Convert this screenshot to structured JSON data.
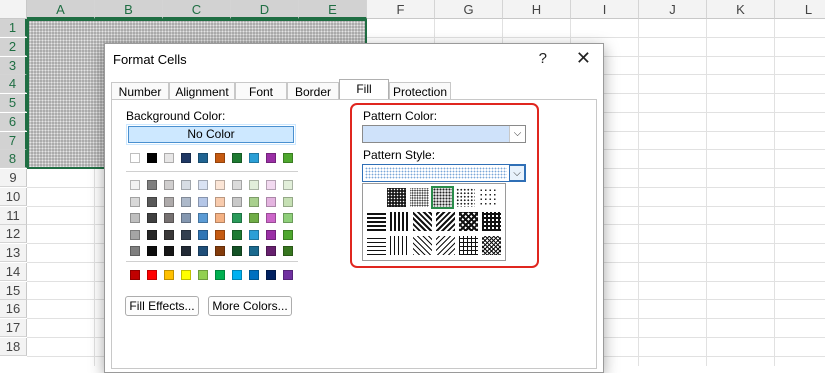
{
  "sheet": {
    "columns": [
      "A",
      "B",
      "C",
      "D",
      "E",
      "F",
      "G",
      "H",
      "I",
      "J",
      "K",
      "L"
    ],
    "rows": [
      "1",
      "2",
      "3",
      "4",
      "5",
      "6",
      "7",
      "8",
      "9",
      "10",
      "11",
      "12",
      "13",
      "14",
      "15",
      "16",
      "17",
      "18"
    ]
  },
  "dialog": {
    "title": "Format Cells",
    "help": "?",
    "close": "✕",
    "tabs": [
      "Number",
      "Alignment",
      "Font",
      "Border",
      "Fill",
      "Protection"
    ],
    "active_tab": "Fill",
    "background_color_label": "Background Color:",
    "no_color_label": "No Color",
    "pattern_color_label": "Pattern Color:",
    "pattern_style_label": "Pattern Style:",
    "fill_effects_label": "Fill Effects...",
    "more_colors_label": "More Colors...",
    "combo_arrow": "⌵"
  },
  "colors": {
    "accent_green": "#1f6e43",
    "highlight_red": "#e0261f",
    "selection_blue": "#cde8ff"
  },
  "palette": {
    "theme_top": [
      "#ffffff",
      "#000000",
      "#e7e6e6",
      "#44546a",
      "#4472c4",
      "#ed7d31",
      "#a5a5a5",
      "#ffc000",
      "#5b9bd5",
      "#70ad47"
    ],
    "theme_top_shown": [
      "#ffffff",
      "#000000",
      "#e7e6e6",
      "#1f3864",
      "#1f6391",
      "#c55a11",
      "#1e7a32",
      "#2b9fd6",
      "#9a2fa5",
      "#4ea72e"
    ],
    "theme_shades": [
      [
        "#f2f2f2",
        "#7f7f7f",
        "#d0cece",
        "#d6dce4",
        "#d9e2f3",
        "#fbe5d6",
        "#dbdbdb",
        "#e2efda",
        "#f2d9f0",
        "#e2efda"
      ],
      [
        "#d8d8d8",
        "#595959",
        "#aeaaaa",
        "#adb9ca",
        "#b4c6e7",
        "#f8cbad",
        "#c9c9c9",
        "#a9d08e",
        "#e4b4e0",
        "#c6e0b4"
      ],
      [
        "#bfbfbf",
        "#404040",
        "#767171",
        "#8497b0",
        "#5b9bd5",
        "#f4b183",
        "#2a9a5a",
        "#70ad47",
        "#cc66c9",
        "#8fcf7a"
      ],
      [
        "#a5a5a5",
        "#262626",
        "#3a3838",
        "#333f4f",
        "#2f75b5",
        "#c55a11",
        "#1e7a32",
        "#2b9fd6",
        "#9a2fa5",
        "#4ea72e"
      ],
      [
        "#7f7f7f",
        "#0d0d0d",
        "#161616",
        "#222a35",
        "#1f4e78",
        "#843c0c",
        "#145226",
        "#1b6a8f",
        "#66206e",
        "#37761f"
      ]
    ],
    "standard": [
      "#c00000",
      "#ff0000",
      "#ffc000",
      "#ffff00",
      "#92d050",
      "#00b050",
      "#00b0f0",
      "#0070c0",
      "#002060",
      "#7030a0"
    ]
  },
  "patterns": [
    [
      "solid-dark",
      "dense-75",
      "dense-50-selected",
      "sparse-25",
      "sparse-12"
    ],
    [
      "h-stripe",
      "v-stripe",
      "diag-down",
      "diag-up",
      "diag-cross",
      "thick-cross"
    ],
    [
      "thin-h",
      "thin-v",
      "thin-diag-down",
      "thin-diag-up",
      "thin-grid",
      "thin-diag-grid"
    ]
  ]
}
